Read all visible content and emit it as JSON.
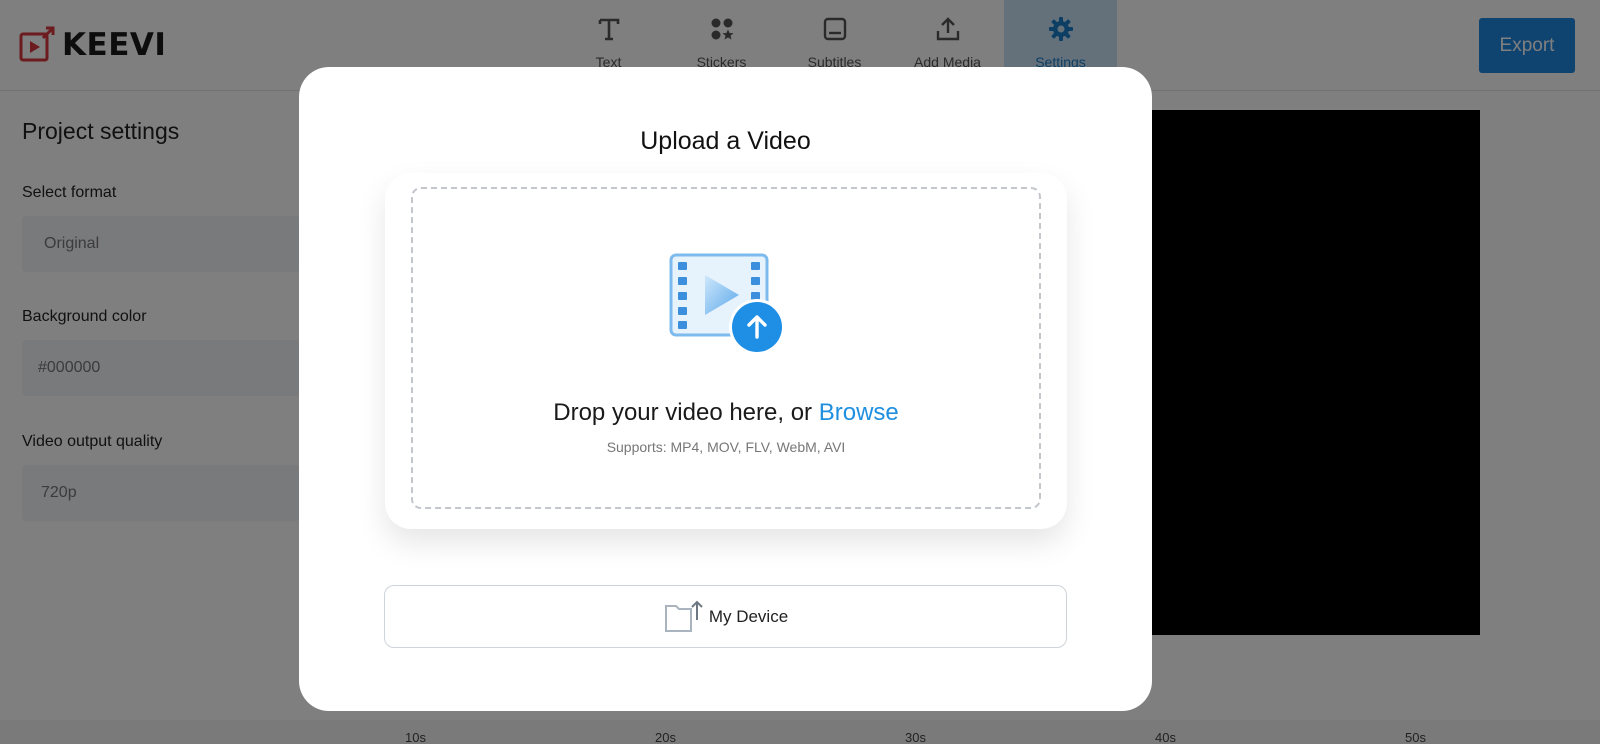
{
  "header": {
    "brand": "KEEVI",
    "tools": [
      {
        "label": "Text",
        "icon": "text-icon"
      },
      {
        "label": "Stickers",
        "icon": "stickers-icon"
      },
      {
        "label": "Subtitles",
        "icon": "subtitles-icon"
      },
      {
        "label": "Add Media",
        "icon": "upload-icon"
      },
      {
        "label": "Settings",
        "icon": "gear-icon",
        "active": true
      }
    ],
    "export_label": "Export"
  },
  "sidebar": {
    "title": "Project settings",
    "format_label": "Select format",
    "format_value": "Original",
    "bg_label": "Background color",
    "bg_value": "#000000",
    "quality_label": "Video output quality",
    "quality_value": "720p"
  },
  "timeline": {
    "ticks": [
      "10s",
      "20s",
      "30s",
      "40s",
      "50s"
    ]
  },
  "modal": {
    "title": "Upload a Video",
    "drop_prefix": "Drop your video here, or ",
    "browse_label": "Browse",
    "supports": "Supports: MP4, MOV, FLV, WebM, AVI",
    "device_label": "My Device"
  },
  "colors": {
    "accent": "#1f86e0",
    "active_tab_bg": "#c9e3f7",
    "logo_red": "#d8363d",
    "preview_bg": "#000000"
  }
}
